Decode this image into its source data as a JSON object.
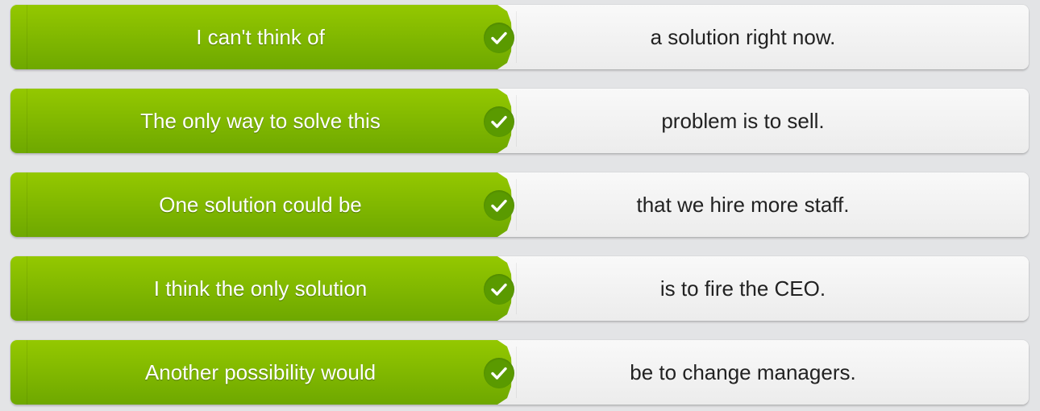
{
  "colors": {
    "tile_green": "#7fb800",
    "check_green": "#5a9a00",
    "answer_bg": "#f3f3f3",
    "page_bg": "#e3e4e6"
  },
  "icons": {
    "check": "checkmark-icon"
  },
  "rows": [
    {
      "left": "I can't think of",
      "right": "a solution right now.",
      "status": "correct"
    },
    {
      "left": "The only way to solve this",
      "right": "problem is to sell.",
      "status": "correct"
    },
    {
      "left": "One solution could be",
      "right": "that we hire more staff.",
      "status": "correct"
    },
    {
      "left": "I think the only solution",
      "right": "is to fire the CEO.",
      "status": "correct"
    },
    {
      "left": "Another possibility would",
      "right": "be to change managers.",
      "status": "correct"
    }
  ]
}
